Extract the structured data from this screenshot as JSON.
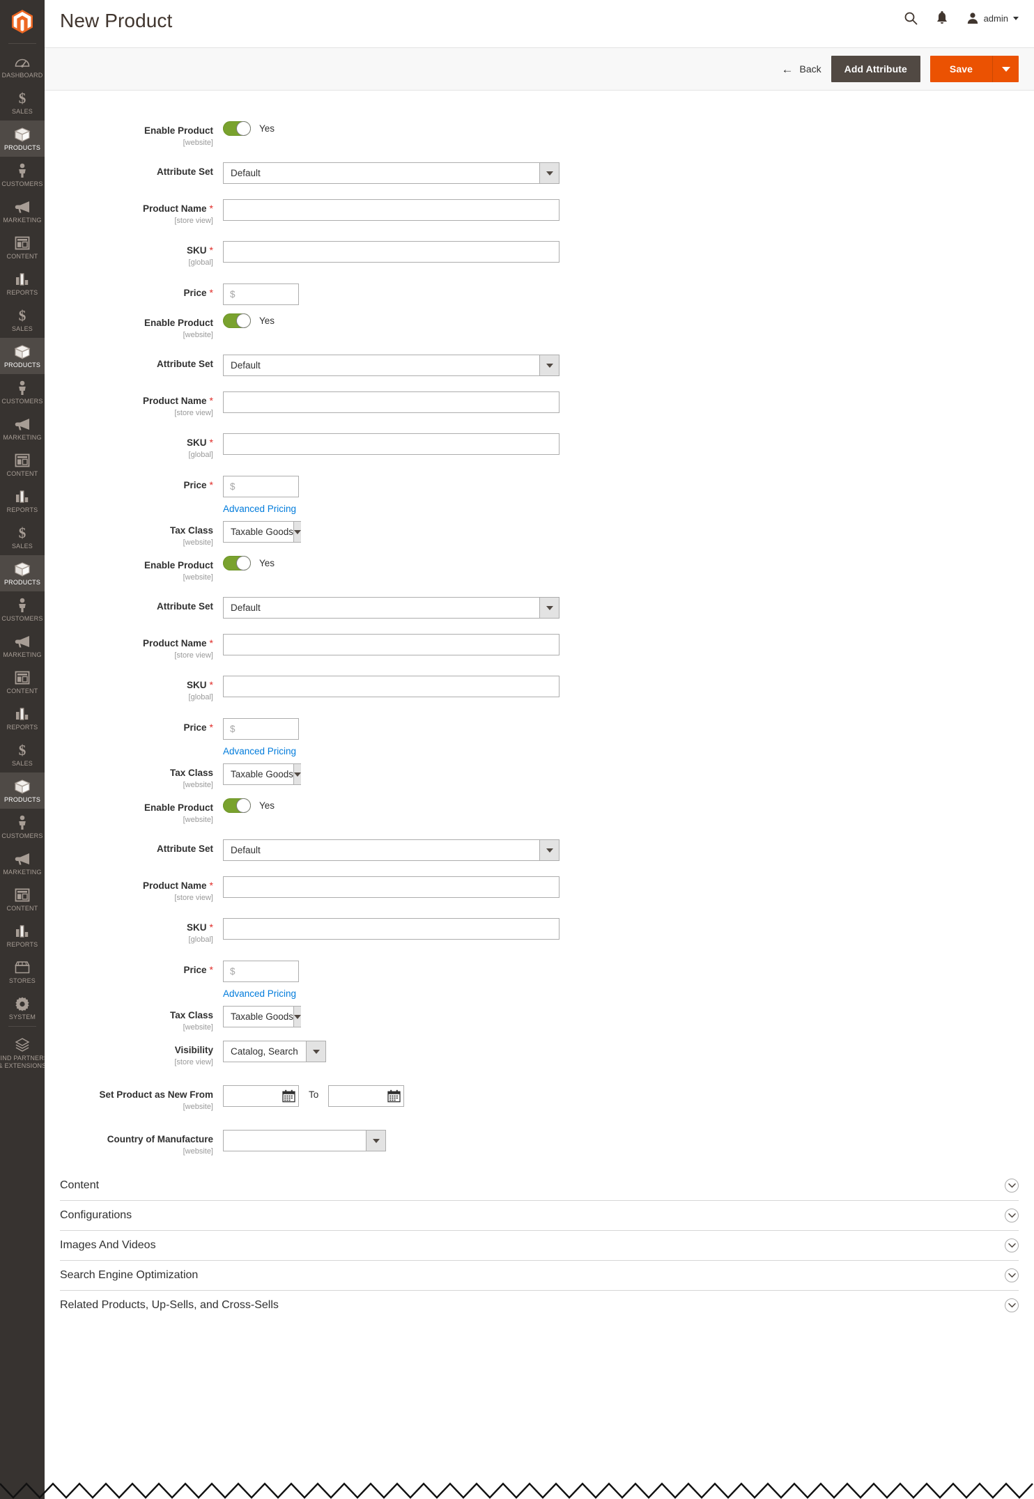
{
  "app": {
    "logo": "magento-logo",
    "page_title": "New Product"
  },
  "sidebar": {
    "items": [
      {
        "label": "Dashboard",
        "icon": "dashboard-icon",
        "active": false
      },
      {
        "label": "Sales",
        "icon": "dollar-icon",
        "active": false
      },
      {
        "label": "Products",
        "icon": "box-icon",
        "active": true
      },
      {
        "label": "Customers",
        "icon": "person-icon",
        "active": false
      },
      {
        "label": "Marketing",
        "icon": "megaphone-icon",
        "active": false
      },
      {
        "label": "Content",
        "icon": "layout-icon",
        "active": false
      },
      {
        "label": "Reports",
        "icon": "bar-chart-icon",
        "active": false
      },
      {
        "label": "Sales",
        "icon": "dollar-icon",
        "active": false
      },
      {
        "label": "Products",
        "icon": "box-icon",
        "active": true
      },
      {
        "label": "Customers",
        "icon": "person-icon",
        "active": false
      },
      {
        "label": "Marketing",
        "icon": "megaphone-icon",
        "active": false
      },
      {
        "label": "Content",
        "icon": "layout-icon",
        "active": false
      },
      {
        "label": "Reports",
        "icon": "bar-chart-icon",
        "active": false
      },
      {
        "label": "Sales",
        "icon": "dollar-icon",
        "active": false
      },
      {
        "label": "Products",
        "icon": "box-icon",
        "active": true
      },
      {
        "label": "Customers",
        "icon": "person-icon",
        "active": false
      },
      {
        "label": "Marketing",
        "icon": "megaphone-icon",
        "active": false
      },
      {
        "label": "Content",
        "icon": "layout-icon",
        "active": false
      },
      {
        "label": "Reports",
        "icon": "bar-chart-icon",
        "active": false
      },
      {
        "label": "Sales",
        "icon": "dollar-icon",
        "active": false
      },
      {
        "label": "Products",
        "icon": "box-icon",
        "active": true
      },
      {
        "label": "Customers",
        "icon": "person-icon",
        "active": false
      },
      {
        "label": "Marketing",
        "icon": "megaphone-icon",
        "active": false
      },
      {
        "label": "Content",
        "icon": "layout-icon",
        "active": false
      },
      {
        "label": "Reports",
        "icon": "bar-chart-icon",
        "active": false
      },
      {
        "label": "Stores",
        "icon": "store-icon",
        "active": false
      },
      {
        "label": "System",
        "icon": "gear-icon",
        "active": false
      }
    ],
    "footer": {
      "label_line1": "Find Partners",
      "label_line2": "& Extensions",
      "icon": "puzzle-icon"
    }
  },
  "header": {
    "search_icon": "search-icon",
    "notifications_icon": "bell-icon",
    "avatar_icon": "user-icon",
    "admin_label": "admin"
  },
  "actionbar": {
    "back_label": "Back",
    "back_icon": "arrow-left-icon",
    "add_attribute_label": "Add Attribute",
    "save_label": "Save",
    "save_split_icon": "caret-down-icon"
  },
  "colors": {
    "brand_orange": "#eb5202",
    "sidebar_bg": "#373330",
    "sidebar_active": "#4f4a46",
    "toggle_on": "#79a22e",
    "link_blue": "#007bdb",
    "required_red": "#e02b27",
    "dark_button": "#514943"
  },
  "form": {
    "blocks": [
      {
        "enable_product": {
          "label": "Enable Product",
          "scope": "[website]",
          "value": "Yes",
          "on": true
        },
        "attribute_set": {
          "label": "Attribute Set",
          "value": "Default"
        },
        "product_name": {
          "label": "Product Name",
          "scope": "[store view]",
          "value": "",
          "required": true
        },
        "sku": {
          "label": "SKU",
          "scope": "[global]",
          "value": "",
          "required": true
        },
        "price": {
          "label": "Price",
          "value": "",
          "placeholder": "$",
          "required": true
        },
        "advanced_pricing": null,
        "tax_class": null
      },
      {
        "enable_product": {
          "label": "Enable Product",
          "scope": "[website]",
          "value": "Yes",
          "on": true
        },
        "attribute_set": {
          "label": "Attribute Set",
          "value": "Default"
        },
        "product_name": {
          "label": "Product Name",
          "scope": "[store view]",
          "value": "",
          "required": true
        },
        "sku": {
          "label": "SKU",
          "scope": "[global]",
          "value": "",
          "required": true
        },
        "price": {
          "label": "Price",
          "value": "",
          "placeholder": "$",
          "required": true
        },
        "advanced_pricing": {
          "label": "Advanced Pricing"
        },
        "tax_class": {
          "label": "Tax Class",
          "scope": "[website]",
          "value": "Taxable Goods"
        }
      },
      {
        "enable_product": {
          "label": "Enable Product",
          "scope": "[website]",
          "value": "Yes",
          "on": true
        },
        "attribute_set": {
          "label": "Attribute Set",
          "value": "Default"
        },
        "product_name": {
          "label": "Product Name",
          "scope": "[store view]",
          "value": "",
          "required": true
        },
        "sku": {
          "label": "SKU",
          "scope": "[global]",
          "value": "",
          "required": true
        },
        "price": {
          "label": "Price",
          "value": "",
          "placeholder": "$",
          "required": true
        },
        "advanced_pricing": {
          "label": "Advanced Pricing"
        },
        "tax_class": {
          "label": "Tax Class",
          "scope": "[website]",
          "value": "Taxable Goods"
        }
      },
      {
        "enable_product": {
          "label": "Enable Product",
          "scope": "[website]",
          "value": "Yes",
          "on": true
        },
        "attribute_set": {
          "label": "Attribute Set",
          "value": "Default"
        },
        "product_name": {
          "label": "Product Name",
          "scope": "[store view]",
          "value": "",
          "required": true
        },
        "sku": {
          "label": "SKU",
          "scope": "[global]",
          "value": "",
          "required": true
        },
        "price": {
          "label": "Price",
          "value": "",
          "placeholder": "$",
          "required": true
        },
        "advanced_pricing": {
          "label": "Advanced Pricing"
        },
        "tax_class": {
          "label": "Tax Class",
          "scope": "[website]",
          "value": "Taxable Goods"
        }
      }
    ],
    "visibility": {
      "label": "Visibility",
      "scope": "[store view]",
      "value": "Catalog, Search"
    },
    "set_new_from": {
      "label": "Set Product as New From",
      "scope": "[website]",
      "from_value": "",
      "to_word": "To",
      "to_value": "",
      "calendar_icon": "calendar-icon"
    },
    "country_of_manufacture": {
      "label": "Country of Manufacture",
      "scope": "[website]",
      "value": ""
    }
  },
  "sections": [
    {
      "title": "Content",
      "chevron": "chevron-down-icon"
    },
    {
      "title": "Configurations",
      "chevron": "chevron-down-icon"
    },
    {
      "title": "Images And Videos",
      "chevron": "chevron-down-icon"
    },
    {
      "title": "Search Engine Optimization",
      "chevron": "chevron-down-icon"
    },
    {
      "title": "Related Products, Up-Sells, and Cross-Sells",
      "chevron": "chevron-down-icon"
    }
  ]
}
